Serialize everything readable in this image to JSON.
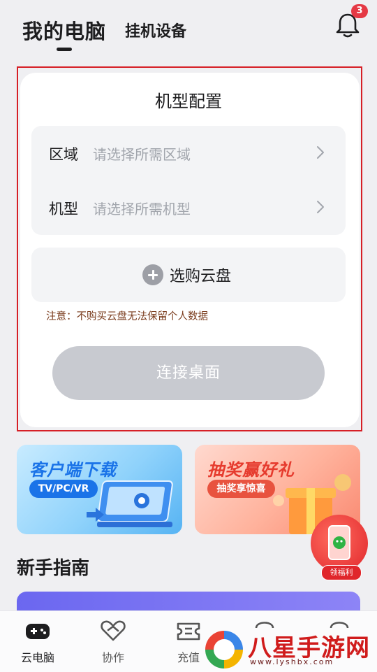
{
  "header": {
    "tab_active": "我的电脑",
    "tab_inactive": "挂机设备",
    "notification_count": "3"
  },
  "config_card": {
    "title": "机型配置",
    "region": {
      "label": "区域",
      "placeholder": "请选择所需区域"
    },
    "model": {
      "label": "机型",
      "placeholder": "请选择所需机型"
    },
    "disk_button": "选购云盘",
    "notice": "注意：不购买云盘无法保留个人数据",
    "connect_button": "连接桌面"
  },
  "banners": {
    "download": {
      "title": "客户端下载",
      "pill": "TV/PC/VR"
    },
    "lottery": {
      "title": "抽奖赢好礼",
      "pill": "抽奖享惊喜"
    },
    "float_label": "领福利"
  },
  "guide": {
    "title": "新手指南"
  },
  "bottom_nav": [
    {
      "label": "云电脑",
      "icon": "gamepad-icon"
    },
    {
      "label": "协作",
      "icon": "heart-handshake-icon"
    },
    {
      "label": "充值",
      "icon": "ticket-icon"
    }
  ],
  "watermark": {
    "text": "八星手游网",
    "url": "www.lyshbx.com"
  },
  "colors": {
    "accent": "#1a73e8",
    "badge": "#e53945",
    "highlight_border": "#d61f26",
    "button_disabled": "#c8cad0"
  }
}
